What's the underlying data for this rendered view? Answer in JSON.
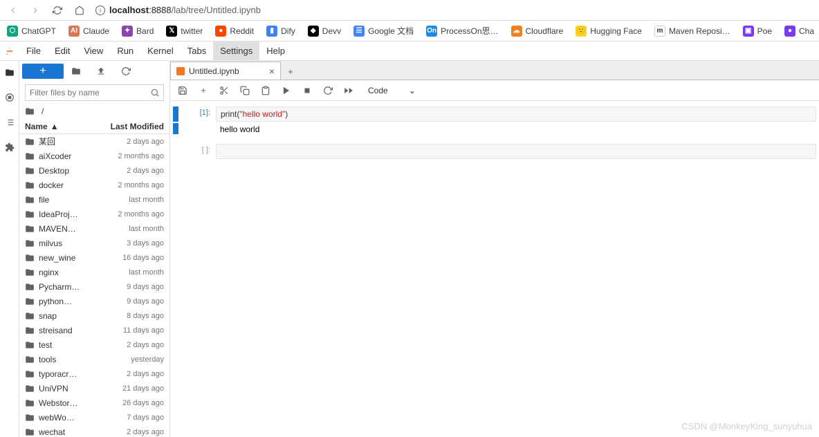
{
  "browser": {
    "url_host": "localhost",
    "url_port": ":8888",
    "url_path": "/lab/tree/Untitled.ipynb"
  },
  "bookmarks": [
    {
      "label": "ChatGPT",
      "color": "#10a37f",
      "initial": "⬡"
    },
    {
      "label": "Claude",
      "color": "#d97757",
      "initial": "AI"
    },
    {
      "label": "Bard",
      "color": "#8e44ad",
      "initial": "✦"
    },
    {
      "label": "twitter",
      "color": "#000",
      "initial": "𝕏"
    },
    {
      "label": "Reddit",
      "color": "#ff4500",
      "initial": "●"
    },
    {
      "label": "Dify",
      "color": "#3b82f6",
      "initial": "▮"
    },
    {
      "label": "Devv",
      "color": "#000",
      "initial": "◆"
    },
    {
      "label": "Google 文档",
      "color": "#4285f4",
      "initial": "☰"
    },
    {
      "label": "ProcessOn思…",
      "color": "#1e88e5",
      "initial": "On"
    },
    {
      "label": "Cloudflare",
      "color": "#f38020",
      "initial": "☁"
    },
    {
      "label": "Hugging Face",
      "color": "#ffd21e",
      "initial": "🙂"
    },
    {
      "label": "Maven Reposi…",
      "color": "#fff",
      "initial": "m"
    },
    {
      "label": "Poe",
      "color": "#7c3aed",
      "initial": "▣"
    },
    {
      "label": "Cha",
      "color": "#7c3aed",
      "initial": "●"
    }
  ],
  "menu": [
    "File",
    "Edit",
    "View",
    "Run",
    "Kernel",
    "Tabs",
    "Settings",
    "Help"
  ],
  "menu_active": "Settings",
  "filebrowser": {
    "filter_placeholder": "Filter files by name",
    "breadcrumb": "/",
    "col_name": "Name",
    "col_modified": "Last Modified",
    "items": [
      {
        "name": "某回",
        "modified": "2 days ago"
      },
      {
        "name": "aiXcoder",
        "modified": "2 months ago"
      },
      {
        "name": "Desktop",
        "modified": "2 days ago"
      },
      {
        "name": "docker",
        "modified": "2 months ago"
      },
      {
        "name": "file",
        "modified": "last month"
      },
      {
        "name": "IdeaProj…",
        "modified": "2 months ago"
      },
      {
        "name": "MAVEN…",
        "modified": "last month"
      },
      {
        "name": "milvus",
        "modified": "3 days ago"
      },
      {
        "name": "new_wine",
        "modified": "16 days ago"
      },
      {
        "name": "nginx",
        "modified": "last month"
      },
      {
        "name": "Pycharm…",
        "modified": "9 days ago"
      },
      {
        "name": "python…",
        "modified": "9 days ago"
      },
      {
        "name": "snap",
        "modified": "8 days ago"
      },
      {
        "name": "streisand",
        "modified": "11 days ago"
      },
      {
        "name": "test",
        "modified": "2 days ago"
      },
      {
        "name": "tools",
        "modified": "yesterday"
      },
      {
        "name": "typoracr…",
        "modified": "2 days ago"
      },
      {
        "name": "UniVPN",
        "modified": "21 days ago"
      },
      {
        "name": "Webstor…",
        "modified": "26 days ago"
      },
      {
        "name": "webWo…",
        "modified": "7 days ago"
      },
      {
        "name": "wechat",
        "modified": "2 days ago"
      }
    ]
  },
  "tab": {
    "title": "Untitled.ipynb"
  },
  "toolbar": {
    "celltype": "Code"
  },
  "cells": [
    {
      "prompt": "[1]:",
      "type": "code",
      "code_prefix": "print(",
      "code_str": "\"hello world\"",
      "code_suffix": ")",
      "output": "hello world"
    },
    {
      "prompt": "[ ]:",
      "type": "code",
      "code": ""
    }
  ],
  "watermark": "CSDN @MonkeyKing_sunyuhua"
}
